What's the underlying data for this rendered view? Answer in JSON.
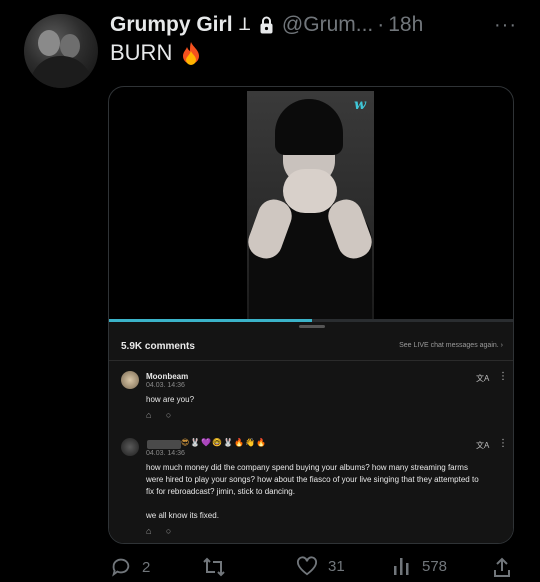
{
  "tweet": {
    "display_name": "Grumpy Girl",
    "name_symbol": "ꓕ",
    "handle": "@Grum...",
    "separator": "·",
    "time": "18h",
    "text": "BURN",
    "more_label": "···"
  },
  "video": {
    "watermark": "w",
    "progress": 0.5
  },
  "comments_panel": {
    "count_label": "5.9K comments",
    "see_live_label": "See LIVE chat messages again. ›",
    "comments": [
      {
        "author": "Moonbeam",
        "date": "04.03. 14:36",
        "text": "how are you?",
        "translate_icon": "translate-icon",
        "more_icon": "more-vertical-icon"
      },
      {
        "author_emojis": "😎🐰💜🤓🐰🔥👋🔥",
        "date": "04.03. 14:36",
        "text_lines": [
          "how much money did the company spend buying your albums?  how many  streaming farms",
          "were hired to play your songs? how about the fiasco of your live singing that they attempted to",
          "fix for rebroadcast?  jimin, stick to dancing.",
          "",
          "we all know its fixed."
        ],
        "translate_icon": "translate-icon",
        "more_icon": "more-vertical-icon"
      }
    ],
    "translate_glyph": "文A",
    "more_glyph": "⋮",
    "action_glyphs": "⌂ ○"
  },
  "actions": {
    "reply_count": "2",
    "retweet_count": "",
    "like_count": "31",
    "views_count": "578"
  },
  "colors": {
    "background": "#000000",
    "text": "#e7e9ea",
    "muted": "#71767b",
    "accent": "#3bb3c9"
  }
}
